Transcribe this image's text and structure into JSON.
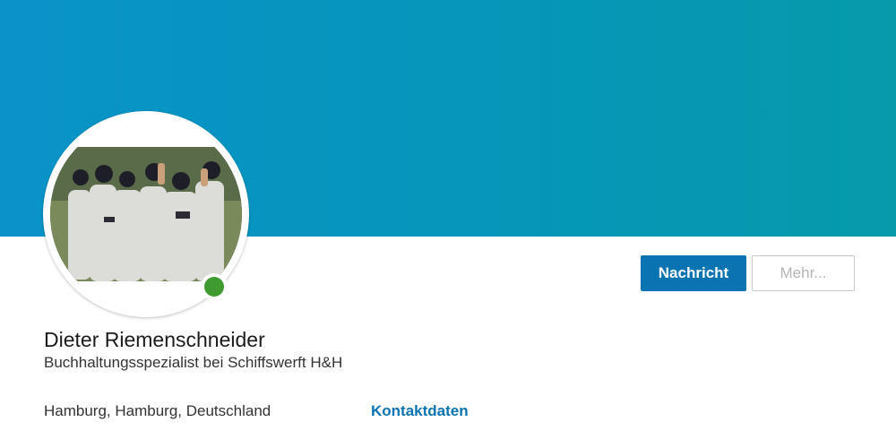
{
  "profile": {
    "name": "Dieter Riemenschneider",
    "headline": "Buchhaltungsspezialist bei Schiffswerft H&H",
    "location": "Hamburg, Hamburg, Deutschland",
    "contact_link": "Kontaktdaten",
    "online_status": "online"
  },
  "actions": {
    "message_label": "Nachricht",
    "more_label": "Mehr..."
  },
  "colors": {
    "banner_start": "#0a93c9",
    "banner_end": "#069aab",
    "primary": "#0a73b1",
    "online": "#3f9b2f"
  }
}
